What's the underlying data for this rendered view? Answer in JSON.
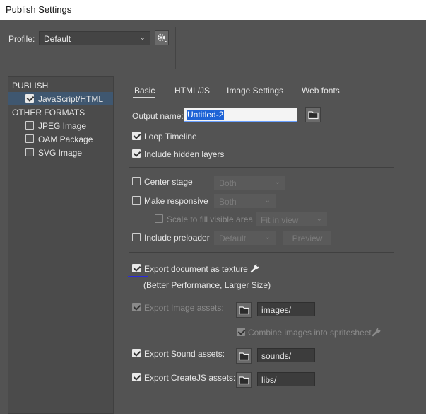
{
  "window": {
    "title": "Publish Settings"
  },
  "profile": {
    "label": "Profile:",
    "value": "Default"
  },
  "sidebar": {
    "publish_header": "PUBLISH",
    "publish_item": "JavaScript/HTML",
    "other_header": "OTHER FORMATS",
    "formats": [
      "JPEG Image",
      "OAM Package",
      "SVG Image"
    ]
  },
  "tabs": [
    "Basic",
    "HTML/JS",
    "Image Settings",
    "Web fonts"
  ],
  "output": {
    "label": "Output name:",
    "value": "Untitled-2"
  },
  "options": {
    "loop_timeline": "Loop Timeline",
    "include_hidden_layers": "Include hidden layers",
    "center_stage": "Center stage",
    "center_stage_value": "Both",
    "make_responsive": "Make responsive",
    "make_responsive_value": "Both",
    "scale_to_fill": "Scale to fill visible area",
    "scale_value": "Fit in view",
    "include_preloader": "Include preloader",
    "preloader_value": "Default",
    "preview_button": "Preview",
    "export_texture": "Export document as texture",
    "texture_note": "(Better Performance, Larger Size)",
    "export_image_assets": "Export Image assets:",
    "image_assets_path": "images/",
    "combine_spritesheet": "Combine images into spritesheet",
    "export_sound_assets": "Export Sound assets:",
    "sound_assets_path": "sounds/",
    "export_createjs_assets": "Export CreateJS assets:",
    "createjs_assets_path": "libs/"
  },
  "colors": {
    "background": "#535353",
    "accent_underline": "#2a2ae0",
    "selected_item": "#3f5770",
    "selection_text_bg": "#1e63d6"
  }
}
